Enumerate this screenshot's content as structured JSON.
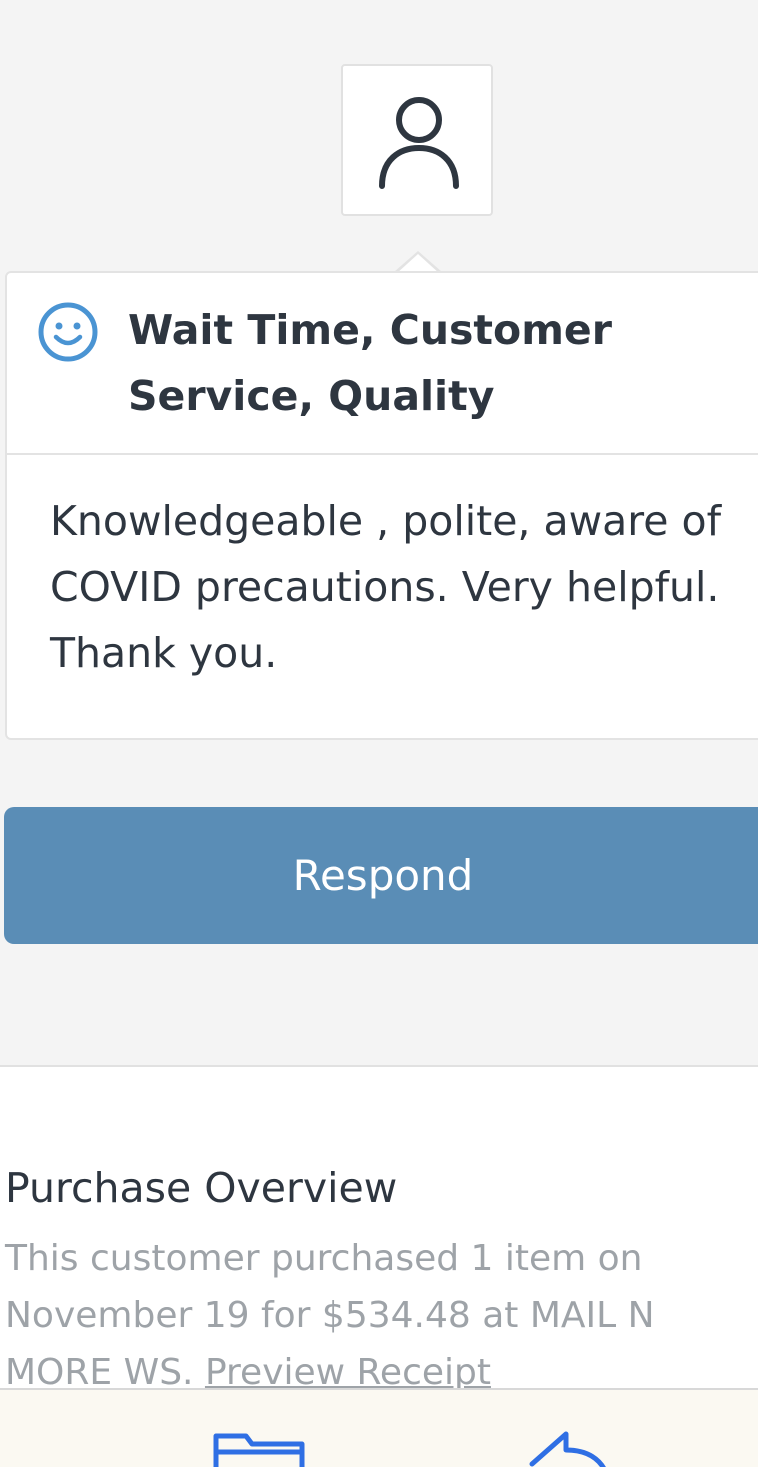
{
  "avatar": {
    "icon": "person-icon"
  },
  "review_card": {
    "sentiment_icon": "smile-icon",
    "accent_color": "#4a94d3",
    "title": "Wait Time, Customer Service, Quality",
    "comment": "Knowledgeable , polite, aware of COVID precautions. Very helpful. Thank you."
  },
  "respond_button": {
    "label": "Respond",
    "color": "#5a8db6"
  },
  "purchase": {
    "title": "Purchase Overview",
    "summary": "This customer purchased 1 item on November 19 for $534.48 at MAIL N MORE WS.",
    "receipt_link": "Preview Receipt"
  },
  "toolbar": {
    "items": [
      {
        "icon": "folder-icon"
      },
      {
        "icon": "share-icon"
      }
    ]
  }
}
